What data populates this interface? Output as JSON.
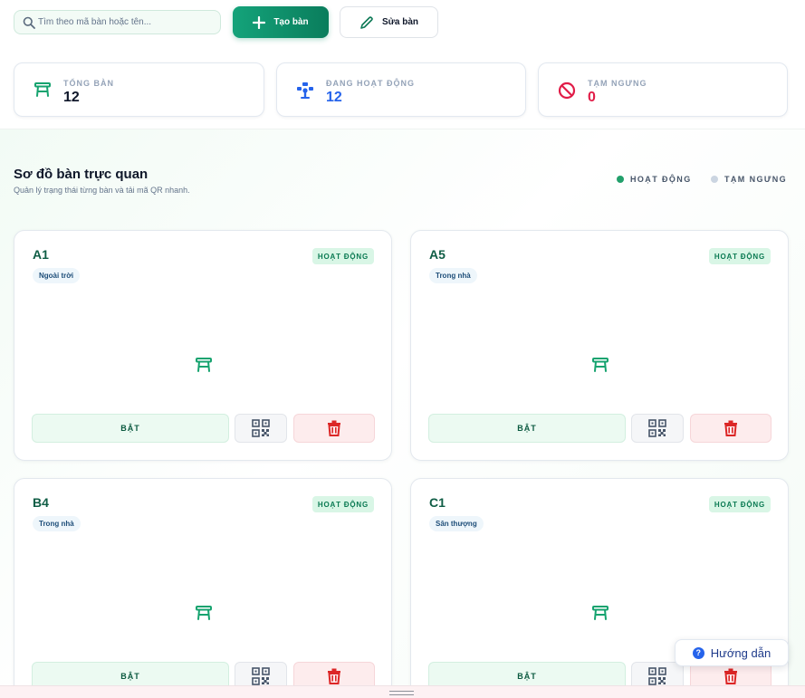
{
  "toolbar": {
    "search_placeholder": "Tìm theo mã bàn hoặc tên...",
    "create_label": "Tạo bàn",
    "edit_label": "Sửa bàn"
  },
  "stats": [
    {
      "label": "TỔNG BÀN",
      "value": "12",
      "color": "#0f172a",
      "icon": "table-icon"
    },
    {
      "label": "ĐANG HOẠT ĐỘNG",
      "value": "12",
      "color": "#2563eb",
      "icon": "active-tables-icon"
    },
    {
      "label": "TẠM NGƯNG",
      "value": "0",
      "color": "#e11d48",
      "icon": "ban-icon"
    }
  ],
  "section": {
    "title": "Sơ đồ bàn trực quan",
    "subtitle": "Quản lý trạng thái từng bàn và tải mã QR nhanh."
  },
  "legend": [
    {
      "label": "HOẠT ĐỘNG",
      "color": "#22a06b"
    },
    {
      "label": "TẠM NGƯNG",
      "color": "#cbd5e1"
    }
  ],
  "tables": [
    {
      "code": "A1",
      "zone": "Ngoài trời",
      "status": "HOẠT ĐỘNG",
      "toggle_label": "BẬT"
    },
    {
      "code": "A5",
      "zone": "Trong nhà",
      "status": "HOẠT ĐỘNG",
      "toggle_label": "BẬT"
    },
    {
      "code": "B4",
      "zone": "Trong nhà",
      "status": "HOẠT ĐỘNG",
      "toggle_label": "BẬT"
    },
    {
      "code": "C1",
      "zone": "Sân thượng",
      "status": "HOẠT ĐỘNG",
      "toggle_label": "BẬT"
    }
  ],
  "help": {
    "label": "Hướng dẫn"
  },
  "colors": {
    "primary": "#0f9d72",
    "status_bg": "#d9f6e6",
    "danger": "#e11d48"
  }
}
